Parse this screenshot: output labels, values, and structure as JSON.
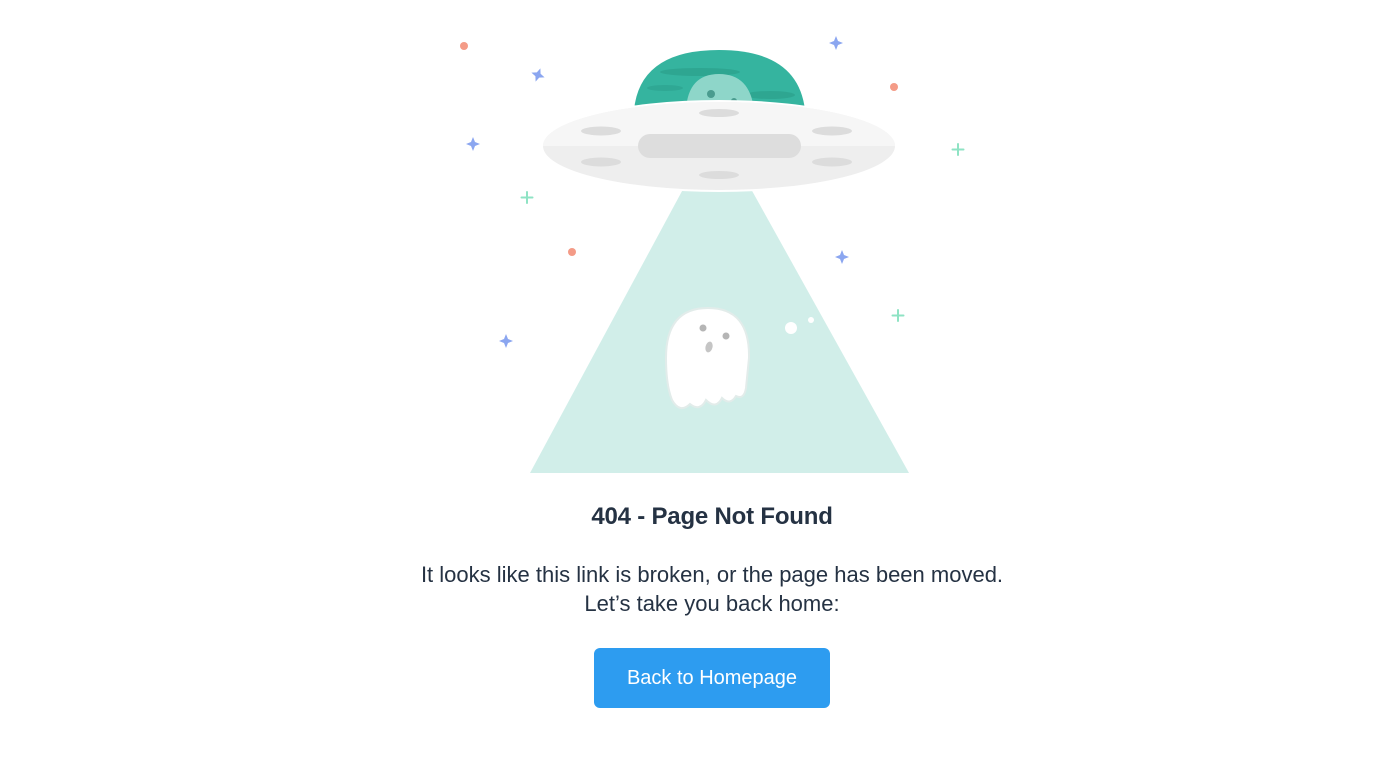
{
  "illustration": {
    "icon": "ufo-abducting-ghost-icon",
    "colors": {
      "beam": "#d1eee9",
      "dome": "#35b49f",
      "saucer": "#f1f1f1",
      "star_blue": "#8ba6f0",
      "star_green": "#8fe3c4",
      "dot_coral": "#f49b87"
    }
  },
  "error": {
    "title": "404 - Page Not Found",
    "message_line1": "It looks like this link is broken, or the page has been moved.",
    "message_line2": "Let’s take you back home:"
  },
  "actions": {
    "back_home_label": "Back to Homepage"
  },
  "colors": {
    "text": "#253243",
    "button": "#2d9cf0",
    "button_text": "#ffffff"
  }
}
